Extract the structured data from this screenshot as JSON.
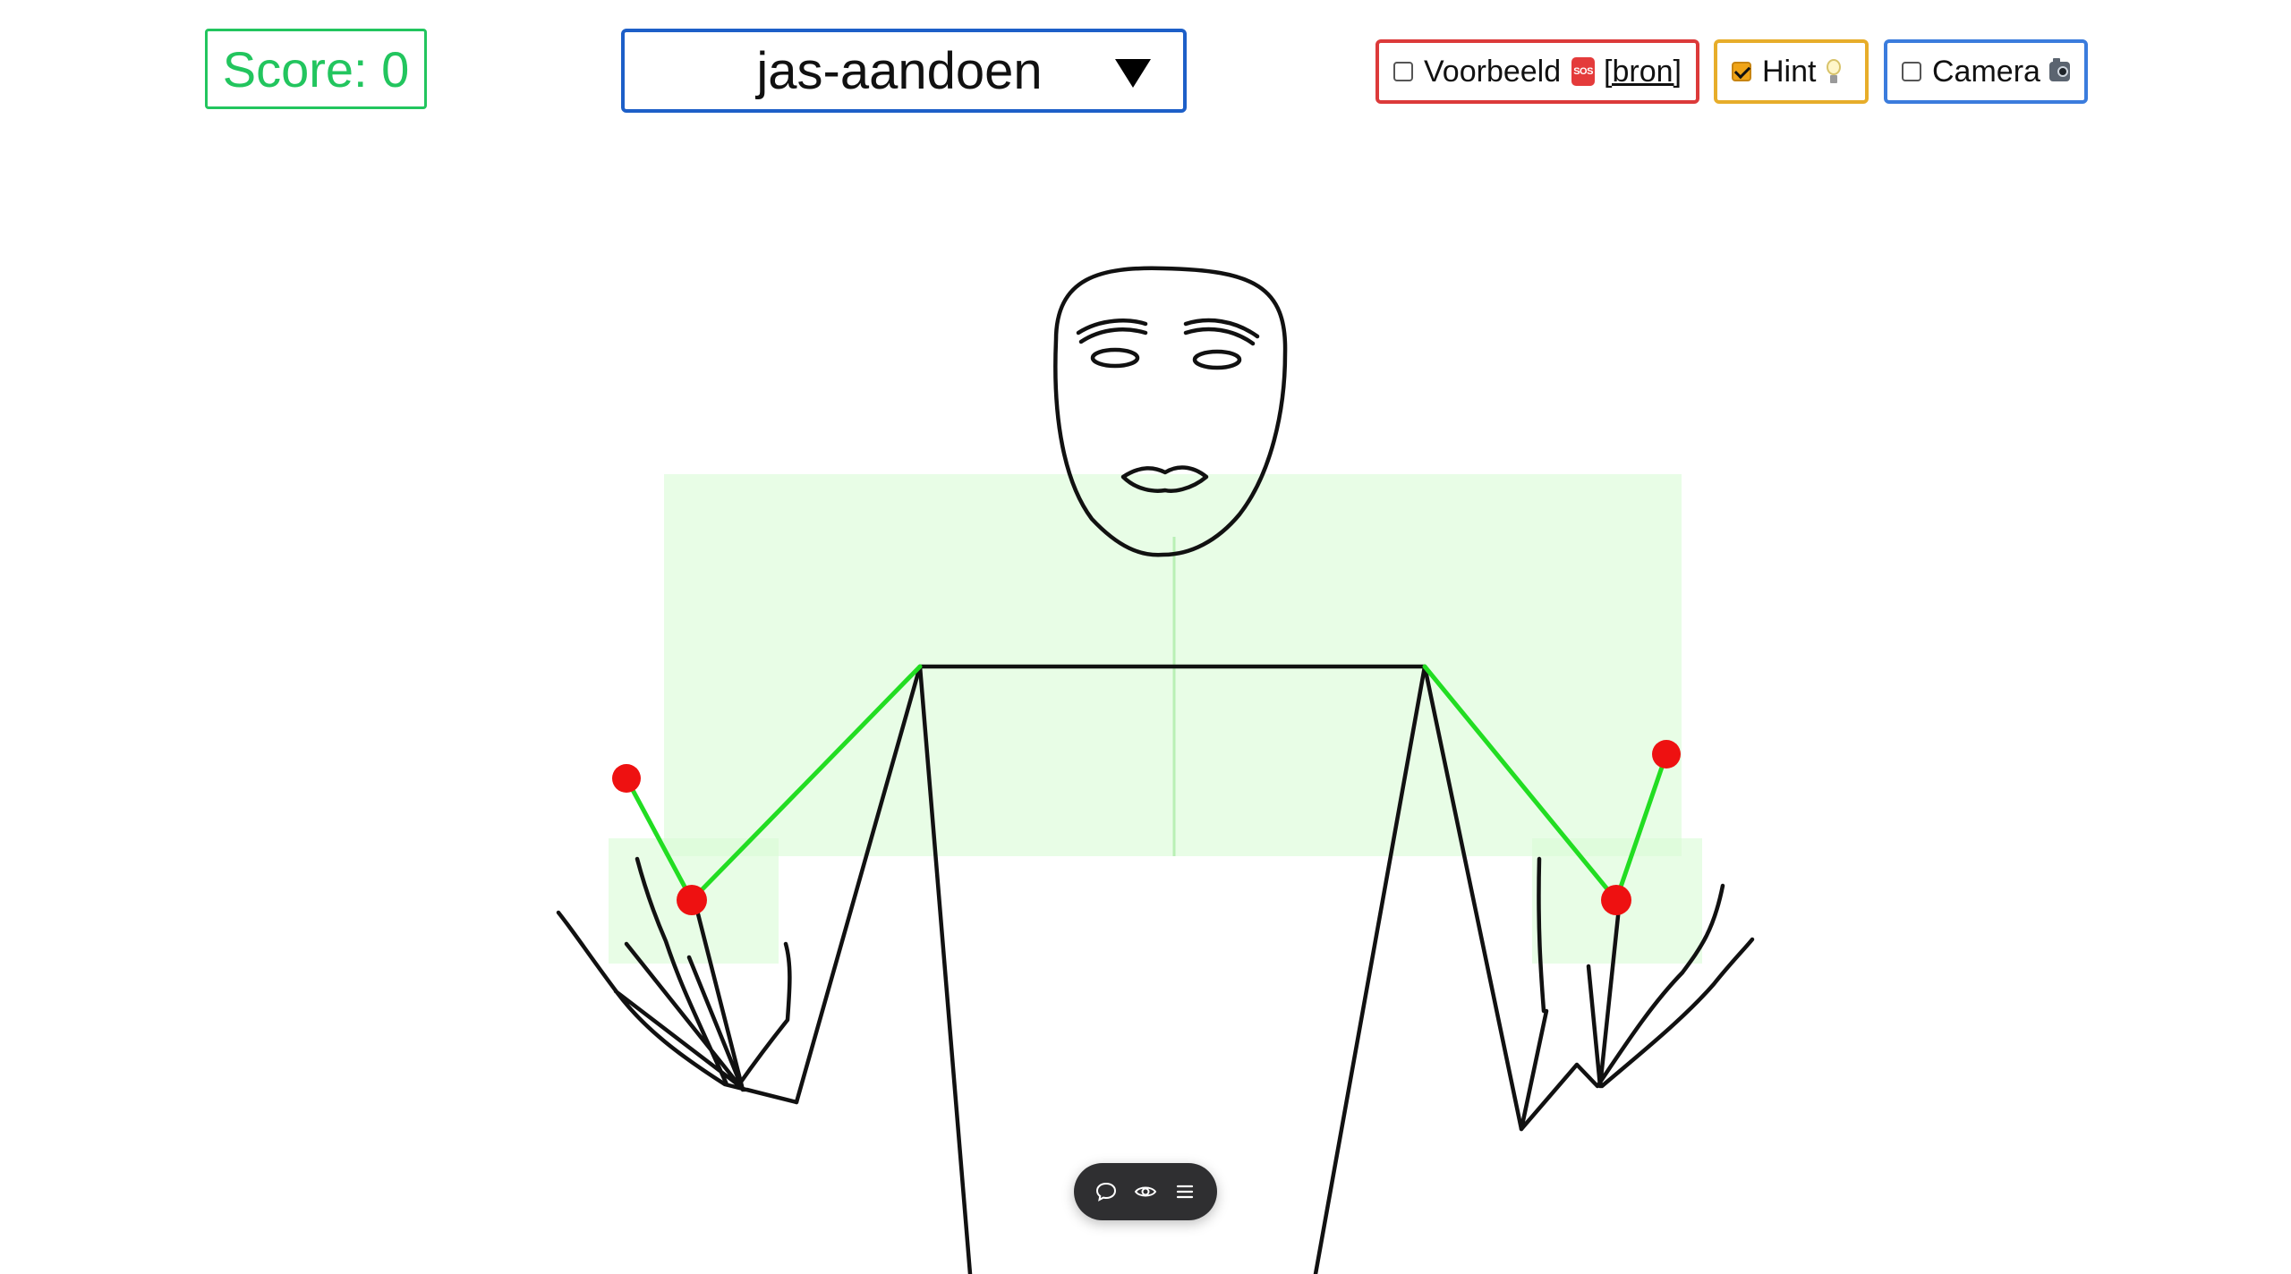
{
  "score": {
    "label": "Score: 0"
  },
  "exercise_select": {
    "selected": "jas-aandoen"
  },
  "toggles": {
    "example": {
      "label": "Voorbeeld",
      "badge": "SOS",
      "link": "[bron]",
      "checked": false,
      "color": "#dc3a3a"
    },
    "hint": {
      "label": "Hint",
      "checked": true,
      "color": "#e7ad2a"
    },
    "camera": {
      "label": "Camera",
      "checked": false,
      "color": "#3b7cdd"
    }
  },
  "figure": {
    "stroke_color": "#111111",
    "guide_color": "#22dd22",
    "joint_color": "#ee1111",
    "zone_color": "#d8fcd6"
  },
  "floating_toolbar": {
    "buttons": [
      "chat-bubble-icon",
      "eye-icon",
      "menu-icon"
    ]
  }
}
